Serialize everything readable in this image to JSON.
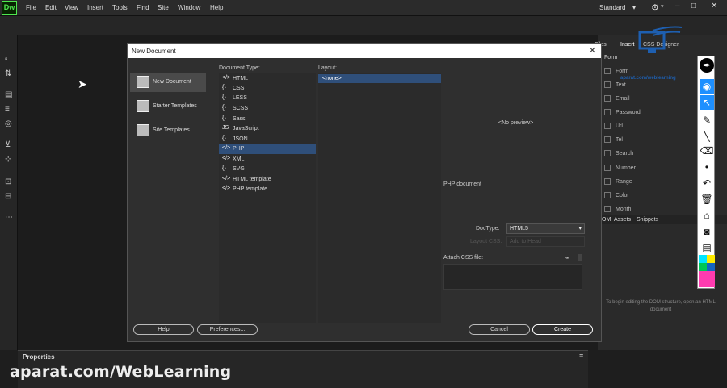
{
  "app": {
    "logo": "Dw"
  },
  "menubar": {
    "items": [
      "File",
      "Edit",
      "View",
      "Insert",
      "Tools",
      "Find",
      "Site",
      "Window",
      "Help"
    ],
    "workspace": "Standard",
    "workspace_arrow": "▾",
    "gear_icon": "⚙",
    "gear_arrow": "▾",
    "minimize": "–",
    "maximize": "□",
    "close": "✕"
  },
  "dialog": {
    "title": "New Document",
    "close": "✕",
    "categories": [
      {
        "label": "New Document",
        "selected": true
      },
      {
        "label": "Starter Templates",
        "selected": false
      },
      {
        "label": "Site Templates",
        "selected": false
      }
    ],
    "doc_type_label": "Document Type:",
    "layout_label": "Layout:",
    "doc_types": [
      {
        "glyph": "</>",
        "label": "HTML"
      },
      {
        "glyph": "{}",
        "label": "CSS"
      },
      {
        "glyph": "{}",
        "label": "LESS"
      },
      {
        "glyph": "{}",
        "label": "SCSS"
      },
      {
        "glyph": "{}",
        "label": "Sass"
      },
      {
        "glyph": "JS",
        "label": "JavaScript"
      },
      {
        "glyph": "{}",
        "label": "JSON"
      },
      {
        "glyph": "</>",
        "label": "PHP",
        "selected": true
      },
      {
        "glyph": "</>",
        "label": "XML"
      },
      {
        "glyph": "{}",
        "label": "SVG"
      },
      {
        "glyph": "</>",
        "label": "HTML template"
      },
      {
        "glyph": "</>",
        "label": "PHP template"
      }
    ],
    "layout_selected": "<none>",
    "preview": "<No preview>",
    "description": "PHP document",
    "doctype_label": "DocType:",
    "doctype_value": "HTML5",
    "layout_css_label": "Layout CSS:",
    "layout_css_value": "Add to Head",
    "attach_css_label": "Attach CSS file:",
    "buttons": {
      "help": "Help",
      "preferences": "Preferences...",
      "cancel": "Cancel",
      "create": "Create"
    }
  },
  "right_panel": {
    "tabs": [
      "Files",
      "Insert",
      "CSS Designer"
    ],
    "form_select": "Form",
    "items": [
      "Form",
      "Text",
      "Email",
      "Password",
      "Url",
      "Tel",
      "Search",
      "Number",
      "Range",
      "Color",
      "Month"
    ],
    "lower_tabs": [
      "DOM",
      "Assets",
      "Snippets"
    ],
    "snippet_text": "To begin editing the DOM structure, open an HTML document"
  },
  "properties": {
    "title": "Properties"
  },
  "watermark": "aparat.com/WebLearning",
  "brand": {
    "url": "aparat.com/weblearning"
  },
  "annotation_colors": [
    "#00e5ff",
    "#ffeb00",
    "#00c853",
    "#ff1493",
    "#1565c0",
    "#000000",
    "#ff3bb0",
    "#ff3bb0"
  ]
}
